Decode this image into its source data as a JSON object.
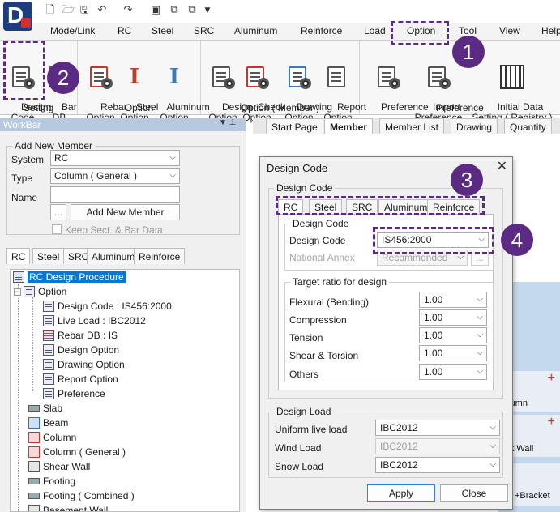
{
  "quick_access": {
    "icons": [
      "new-file-icon",
      "open-file-icon",
      "save-icon",
      "undo-icon",
      "redo-icon",
      "view-icon",
      "copy-icon",
      "paste-icon",
      "dropdown-icon"
    ]
  },
  "menu": {
    "tabs": [
      "Mode/Link",
      "RC",
      "Steel",
      "SRC",
      "Aluminum",
      "Reinforce",
      "Load",
      "Option",
      "Tool",
      "View",
      "Help"
    ],
    "active": "Option"
  },
  "ribbon": {
    "setting": {
      "label": "Setting",
      "design_code": "Design\nCode",
      "bar_db": "Bar\nDB"
    },
    "option": {
      "label": "Option",
      "rebar": "Rebar\nOption",
      "steel": "Steel\nOption",
      "aluminum": "Aluminum\nOption"
    },
    "option_member": {
      "label": "Option ( Member )",
      "design": "Design\nOption",
      "check": "Check\nOption",
      "drawing": "Drawing\nOption",
      "report": "Report\nOption"
    },
    "preference": {
      "label": "Preference",
      "preference": "Preference",
      "import": "Import\nPreference",
      "initial": "Initial Data\nSetting ( Registry )"
    }
  },
  "callouts": [
    "1",
    "2",
    "3",
    "4"
  ],
  "workbar": {
    "title": "WorkBar",
    "pin": "▼  ⊥",
    "add_new_member": "Add New Member",
    "system_label": "System",
    "system_value": "RC",
    "type_label": "Type",
    "type_value": "Column ( General )",
    "name_label": "Name",
    "name_value": "",
    "ellipsis": "...",
    "add_button": "Add New Member",
    "keep_label": "Keep Sect. & Bar Data",
    "tabs": [
      "RC",
      "Steel",
      "SRC",
      "Aluminum",
      "Reinforce"
    ],
    "tree": {
      "root": "RC Design Procedure",
      "option": "Option",
      "children": [
        "Design Code : IS456:2000",
        "Live Load : IBC2012",
        "Rebar DB : IS",
        "Design Option",
        "Drawing Option",
        "Report Option",
        "Preference"
      ],
      "members": [
        "Slab",
        "Beam",
        "Column",
        "Column ( General )",
        "Shear Wall",
        "Footing",
        "Footing ( Combined )",
        "Basement Wall"
      ]
    }
  },
  "main_tabs": [
    "Start Page",
    "Member",
    "Member List",
    "Drawing",
    "Quantity"
  ],
  "side_panel": {
    "column": "olumn",
    "wall": "ent Wall",
    "bracket": "+Bracket"
  },
  "dialog": {
    "title": "Design Code",
    "close": "✕",
    "group_label": "Design Code",
    "tabs": [
      "RC",
      "Steel",
      "SRC",
      "Aluminum",
      "Reinforce"
    ],
    "inner_group": "Design Code",
    "design_code_label": "Design Code",
    "design_code_value": "IS456:2000",
    "national_annex_label": "National Annex",
    "national_annex_value": "Recommended",
    "annex_btn": "...",
    "target_ratio_label": "Target ratio for design",
    "ratios": [
      {
        "label": "Flexural (Bending)",
        "value": "1.00"
      },
      {
        "label": "Compression",
        "value": "1.00"
      },
      {
        "label": "Tension",
        "value": "1.00"
      },
      {
        "label": "Shear & Torsion",
        "value": "1.00"
      },
      {
        "label": "Others",
        "value": "1.00"
      }
    ],
    "design_load_label": "Design Load",
    "uniform_live_label": "Uniform live load",
    "uniform_live_value": "IBC2012",
    "wind_label": "Wind Load",
    "wind_value": "IBC2012",
    "snow_label": "Snow Load",
    "snow_value": "IBC2012",
    "apply": "Apply",
    "close_btn": "Close"
  },
  "colors": {
    "callout": "#5b2a82",
    "selection": "#0078d7",
    "workbar_title": "#b7c9de"
  }
}
